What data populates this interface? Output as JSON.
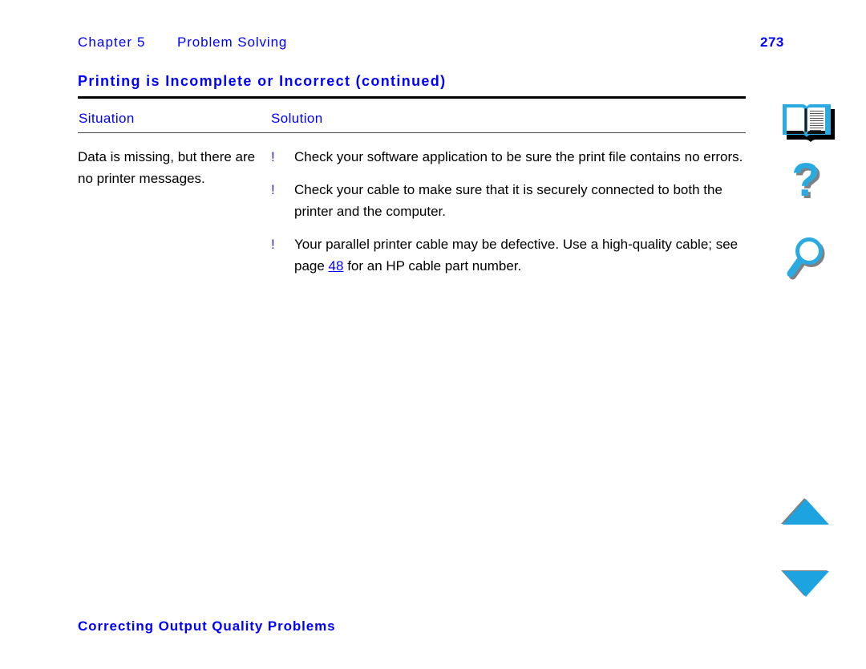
{
  "document": {
    "type": "printer-user-guide-page",
    "page_number": "273"
  },
  "running_header": {
    "chapter_label": "Chapter 5",
    "chapter_title": "Problem Solving",
    "page_number": "273"
  },
  "section": {
    "heading": "Printing is Incomplete or Incorrect (continued)"
  },
  "table": {
    "columns": [
      {
        "header": "Situation"
      },
      {
        "header": "Solution"
      }
    ],
    "rows": [
      {
        "situation": "Data is missing, but there are no printer messages.",
        "solution_bullets": [
          {
            "marker": "!",
            "text_before": "Check your software application to be sure the print file contains no errors.",
            "link": null,
            "text_after": null
          },
          {
            "marker": "!",
            "text_before": "Check your cable to make sure that it is securely connected to both the printer and the computer.",
            "link": null,
            "text_after": null
          },
          {
            "marker": "!",
            "text_before": "Your parallel printer cable may be defective. Use a high-quality cable; see page ",
            "link": "48",
            "text_after": " for an HP cable part number."
          }
        ]
      }
    ]
  },
  "footer": {
    "link_label": "Correcting Output Quality Problems"
  },
  "nav_rail": {
    "buttons": [
      {
        "name": "table-of-contents",
        "icon": "open-book-icon",
        "label": "Table of Contents"
      },
      {
        "name": "help",
        "icon": "question-mark-icon",
        "label": "Help"
      },
      {
        "name": "find",
        "icon": "magnifier-icon",
        "label": "Find"
      },
      {
        "name": "previous-page",
        "icon": "triangle-up-icon",
        "label": "Previous Page"
      },
      {
        "name": "next-page",
        "icon": "triangle-down-icon",
        "label": "Next Page"
      }
    ]
  },
  "colors": {
    "link_blue": "#0000ff",
    "icon_cyan": "#29abe2",
    "icon_shadow": "#808080",
    "rule_dark": "#000000",
    "rule_light": "#4a4a4a",
    "body_text": "#000000"
  }
}
